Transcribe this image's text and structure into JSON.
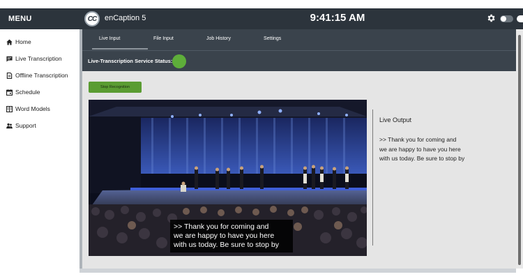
{
  "topbar": {
    "menu_label": "MENU",
    "logo_text": "CC",
    "app_title": "enCaption 5",
    "clock": "9:41:15 AM",
    "icons": [
      "gear-icon",
      "toggle-switch"
    ]
  },
  "sidebar": {
    "items": [
      {
        "label": "Home",
        "icon": "home-icon"
      },
      {
        "label": "Live Transcription",
        "icon": "chat-icon"
      },
      {
        "label": "Offline Transcription",
        "icon": "document-icon"
      },
      {
        "label": "Schedule",
        "icon": "calendar-icon"
      },
      {
        "label": "Word Models",
        "icon": "book-icon"
      },
      {
        "label": "Support",
        "icon": "people-icon"
      }
    ]
  },
  "main": {
    "tabs": [
      {
        "label": "Live Input",
        "active": true
      },
      {
        "label": "File Input"
      },
      {
        "label": "Job History"
      },
      {
        "label": "Settings"
      }
    ],
    "status_label": "Live-Transcription Service Status:",
    "status_color": "#5eae3a",
    "stop_button": "Stop Recognition",
    "caption_lines": [
      ">> Thank you for coming and",
      "we are happy to have you here",
      "with us today. Be sure to stop by"
    ],
    "output": {
      "title": "Live Output",
      "lines": [
        ">> Thank you for coming and",
        "we are happy to have you here",
        "with us today. Be sure to stop by"
      ]
    }
  },
  "colors": {
    "topbar_bg": "#2c343c",
    "panel_bg": "#3a434c",
    "content_bg": "#e5e5e5",
    "accent_green": "#5a9c32"
  }
}
